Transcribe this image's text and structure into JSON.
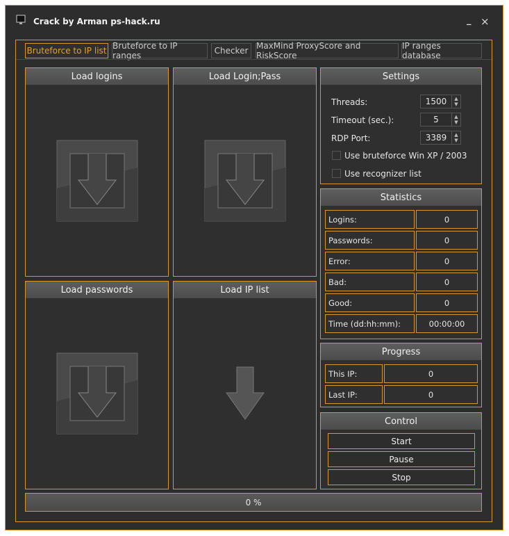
{
  "window": {
    "title": "Crack by Arman ps-hack.ru",
    "minimize": "_",
    "close": "×"
  },
  "tabs": [
    "Bruteforce to IP list",
    "Bruteforce to IP ranges",
    "Checker",
    "MaxMind ProxyScore and RiskScore",
    "IP ranges database"
  ],
  "load_panels": {
    "logins": "Load logins",
    "loginpass": "Load Login;Pass",
    "passwords": "Load passwords",
    "iplist": "Load IP list"
  },
  "settings": {
    "title": "Settings",
    "threads_label": "Threads:",
    "threads": "1500",
    "timeout_label": "Timeout (sec.):",
    "timeout": "5",
    "rdp_label": "RDP Port:",
    "rdp": "3389",
    "winxp": "Use bruteforce Win XP / 2003",
    "recognizer": "Use recognizer list"
  },
  "statistics": {
    "title": "Statistics",
    "rows": [
      [
        "Logins:",
        "0"
      ],
      [
        "Passwords:",
        "0"
      ],
      [
        "Error:",
        "0"
      ],
      [
        "Bad:",
        "0"
      ],
      [
        "Good:",
        "0"
      ],
      [
        "Time (dd:hh:mm):",
        "00:00:00"
      ]
    ]
  },
  "progress": {
    "title": "Progress",
    "this_ip_label": "This IP:",
    "this_ip": "0",
    "last_ip_label": "Last IP:",
    "last_ip": "0"
  },
  "control": {
    "title": "Control",
    "start": "Start",
    "pause": "Pause",
    "stop": "Stop"
  },
  "progress_bar": {
    "text": "0 %",
    "value": 0
  },
  "colors": {
    "accent": "#d9962a",
    "background": "#2d2d2d"
  }
}
